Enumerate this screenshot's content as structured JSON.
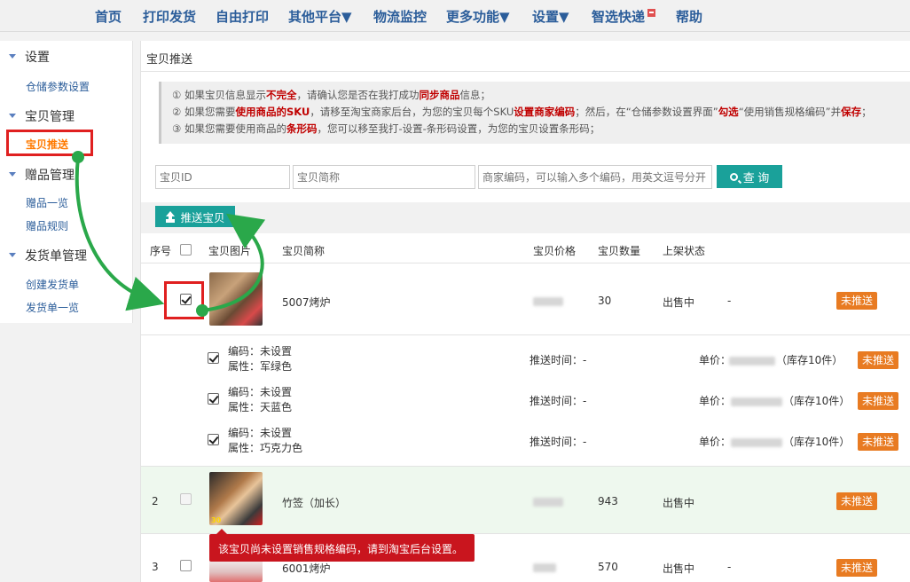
{
  "nav": {
    "items": [
      "首页",
      "打印发货",
      "自由打印",
      "其他平台▼",
      "物流监控",
      "更多功能▼",
      "设置▼",
      "智选快递",
      "帮助"
    ]
  },
  "sidebar": {
    "group_settings": "设置",
    "item_storage_settings": "仓储参数设置",
    "group_goods": "宝贝管理",
    "item_push_goods": "宝贝推送",
    "group_gift": "赠品管理",
    "item_gift_list": "赠品一览",
    "item_gift_rules": "赠品规则",
    "group_invoice": "发货单管理",
    "item_create_invoice": "创建发货单",
    "item_invoice_list": "发货单一览"
  },
  "panel": {
    "title": "宝贝推送",
    "tip1_pre": "① 如果宝贝信息显示",
    "tip1_b1": "不完全",
    "tip1_mid": "，请确认您是否在我打成功",
    "tip1_b2": "同步商品",
    "tip1_post": "信息；",
    "tip2_pre": "② 如果您需要",
    "tip2_b1": "使用商品的SKU",
    "tip2_mid1": "，请移至淘宝商家后台，为您的宝贝每个SKU",
    "tip2_b2": "设置商家编码",
    "tip2_mid2": "；然后，在“仓储参数设置界面”",
    "tip2_b3": "勾选",
    "tip2_mid3": "“使用销售规格编码”并",
    "tip2_b4": "保存",
    "tip2_post": "；",
    "tip3_pre": "③ 如果您需要使用商品的",
    "tip3_b1": "条形码",
    "tip3_post": "，您可以移至我打-设置-条形码设置，为您的宝贝设置条形码；"
  },
  "search": {
    "id_placeholder": "宝贝ID",
    "name_placeholder": "宝贝简称",
    "code_placeholder": "商家编码，可以输入多个编码，用英文逗号分开",
    "button_label": "查 询"
  },
  "toolbar": {
    "push_label": "推送宝贝"
  },
  "table": {
    "headers": {
      "index": "序号",
      "image": "宝贝图片",
      "name": "宝贝简称",
      "price": "宝贝价格",
      "qty": "宝贝数量",
      "status": "上架状态"
    },
    "rows": [
      {
        "index": "1",
        "name": "5007烤炉",
        "qty": "30",
        "status": "出售中",
        "extra": "-",
        "push": "未推送"
      },
      {
        "index": "2",
        "name": "竹签（加长）",
        "qty": "943",
        "status": "出售中",
        "extra": "-",
        "push": "未推送"
      },
      {
        "index": "3",
        "name": "6001烤炉",
        "qty": "570",
        "status": "出售中",
        "extra": "-",
        "push": "未推送"
      }
    ],
    "skus": [
      {
        "code": "编码：未设置",
        "attr": "属性：军绿色",
        "push_time": "推送时间：-",
        "price_label": "单价：",
        "stock": "（库存10件）",
        "push": "未推送"
      },
      {
        "code": "编码：未设置",
        "attr": "属性：天蓝色",
        "push_time": "推送时间：-",
        "price_label": "单价：",
        "stock": "（库存10件）",
        "push": "未推送"
      },
      {
        "code": "编码：未设置",
        "attr": "属性：巧克力色",
        "push_time": "推送时间：-",
        "price_label": "单价：",
        "stock": "（库存10件）",
        "push": "未推送"
      }
    ],
    "thumb2_caption": "30",
    "tooltip": "该宝贝尚未设置销售规格编码，请到淘宝后台设置。"
  },
  "colors": {
    "nav_text": "#2b5d9a",
    "accent_teal": "#1aa19a",
    "push_orange": "#e87b22",
    "highlight_red": "#e02020",
    "arrow_green": "#2aa84a",
    "tooltip_red": "#c9151e"
  }
}
